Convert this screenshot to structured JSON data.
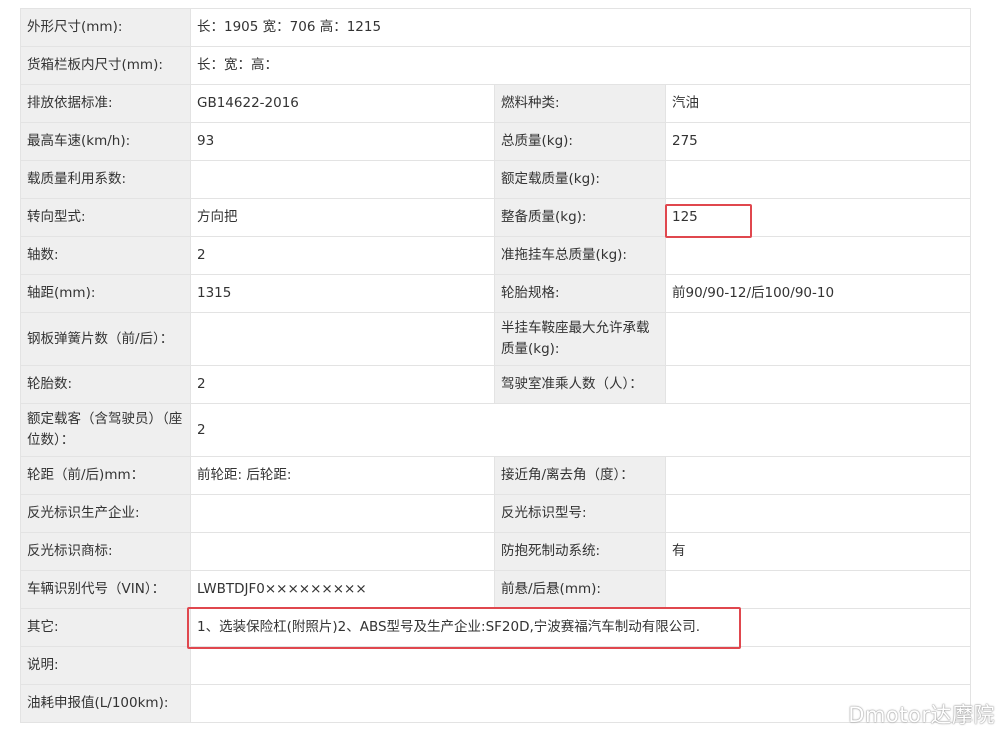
{
  "rows": [
    {
      "label": "外形尺寸(mm):",
      "value": "长：1905 宽：706 高：1215"
    },
    {
      "label": "货箱栏板内尺寸(mm):",
      "value": "长：宽：高："
    },
    {
      "label": "排放依据标准:",
      "value": "GB14622-2016",
      "label2": "燃料种类:",
      "value2": "汽油"
    },
    {
      "label": "最高车速(km/h):",
      "value": "93",
      "label2": "总质量(kg):",
      "value2": "275"
    },
    {
      "label": "载质量利用系数:",
      "value": "",
      "label2": "额定载质量(kg):",
      "value2": ""
    },
    {
      "label": "转向型式:",
      "value": "方向把",
      "label2": "整备质量(kg):",
      "value2": "125"
    },
    {
      "label": "轴数:",
      "value": "2",
      "label2": "准拖挂车总质量(kg):",
      "value2": ""
    },
    {
      "label": "轴距(mm):",
      "value": "1315",
      "label2": "轮胎规格:",
      "value2": "前90/90-12/后100/90-10"
    },
    {
      "label": "钢板弹簧片数（前/后）：",
      "value": "",
      "label2": "半挂车鞍座最大允许承载质量(kg):",
      "value2": ""
    },
    {
      "label": "轮胎数:",
      "value": "2",
      "label2": "驾驶室准乘人数（人）：",
      "value2": ""
    },
    {
      "label": "额定载客（含驾驶员）（座位数）：",
      "value": "2"
    },
    {
      "label": "轮距（前/后)mm：",
      "value": "前轮距: 后轮距:",
      "label2": "接近角/离去角（度）：",
      "value2": ""
    },
    {
      "label": "反光标识生产企业:",
      "value": "",
      "label2": "反光标识型号:",
      "value2": ""
    },
    {
      "label": "反光标识商标:",
      "value": "",
      "label2": "防抱死制动系统:",
      "value2": "有"
    },
    {
      "label": "车辆识别代号（VIN）：",
      "value": "LWBTDJF0×××××××××",
      "label2": "前悬/后悬(mm):",
      "value2": ""
    },
    {
      "label": "其它:",
      "value": "1、选装保险杠(附照片)2、ABS型号及生产企业:SF20D,宁波赛福汽车制动有限公司."
    },
    {
      "label": "说明:",
      "value": ""
    },
    {
      "label": "油耗申报值(L/100km):",
      "value": ""
    }
  ],
  "watermark": "Dmotor达摩院"
}
